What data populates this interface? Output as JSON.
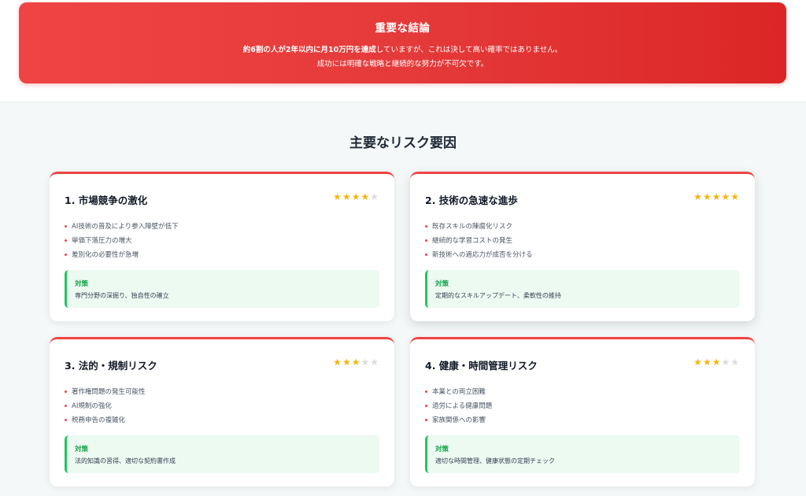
{
  "conclusion": {
    "title": "重要な結論",
    "line1_bold": "約6割の人が2年以内に月10万円を達成",
    "line1_rest": "していますが、これは決して高い確率ではありません。",
    "line2": "成功には明確な戦略と継続的な努力が不可欠です。",
    "accent_color": "#ef4444"
  },
  "section": {
    "title": "主要なリスク要因"
  },
  "star_color": "#f5b50a",
  "cards": [
    {
      "title": "1. 市場競争の激化",
      "rating": 4,
      "max_rating": 5,
      "items": [
        "AI技術の普及により参入障壁が低下",
        "単価下落圧力の増大",
        "差別化の必要性が急増"
      ],
      "countermeasure_label": "対策",
      "countermeasure": "専門分野の深掘り、独自性の確立"
    },
    {
      "title": "2. 技術の急速な進歩",
      "rating": 5,
      "max_rating": 5,
      "items": [
        "既存スキルの陳腐化リスク",
        "継続的な学習コストの発生",
        "新技術への適応力が成否を分ける"
      ],
      "countermeasure_label": "対策",
      "countermeasure": "定期的なスキルアップデート、柔軟性の維持"
    },
    {
      "title": "3. 法的・規制リスク",
      "rating": 3,
      "max_rating": 5,
      "items": [
        "著作権問題の発生可能性",
        "AI規制の強化",
        "税務申告の複雑化"
      ],
      "countermeasure_label": "対策",
      "countermeasure": "法的知識の習得、適切な契約書作成"
    },
    {
      "title": "4. 健康・時間管理リスク",
      "rating": 3,
      "max_rating": 5,
      "items": [
        "本業との両立困難",
        "過労による健康問題",
        "家族関係への影響"
      ],
      "countermeasure_label": "対策",
      "countermeasure": "適切な時間管理、健康状態の定期チェック"
    }
  ]
}
